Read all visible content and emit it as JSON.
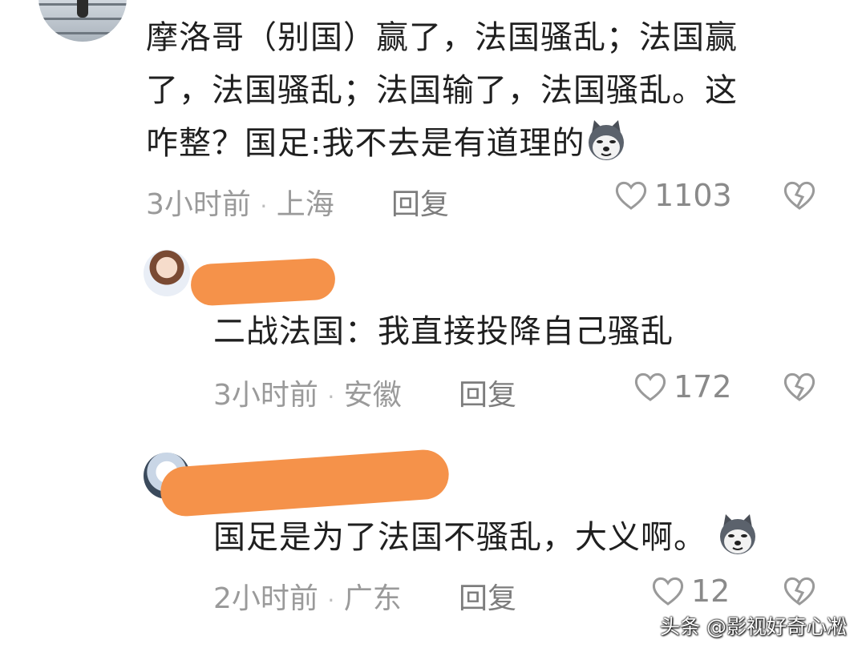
{
  "main_comment": {
    "text_line1": "摩洛哥（别国）赢了，法国骚乱；法国赢",
    "text_line2": "了，法国骚乱；法国输了，法国骚乱。这",
    "text_line3": "咋整？国足:我不去是有道理的",
    "time": "3小时前",
    "location": "上海",
    "reply_label": "回复",
    "likes": "1103"
  },
  "replies": [
    {
      "text": "二战法国：我直接投降自己骚乱",
      "time": "3小时前",
      "location": "安徽",
      "reply_label": "回复",
      "likes": "172"
    },
    {
      "text": "国足是为了法国不骚乱，大义啊。",
      "time": "2小时前",
      "location": "广东",
      "reply_label": "回复",
      "likes": "12"
    }
  ],
  "watermark": "头条 @影视好奇心凇",
  "separator": "·",
  "icons": [
    "heart-icon",
    "broken-heart-icon",
    "husky-emoji-icon"
  ],
  "colors": {
    "redaction": "#f5924a",
    "meta_text": "#9a9a9a"
  }
}
